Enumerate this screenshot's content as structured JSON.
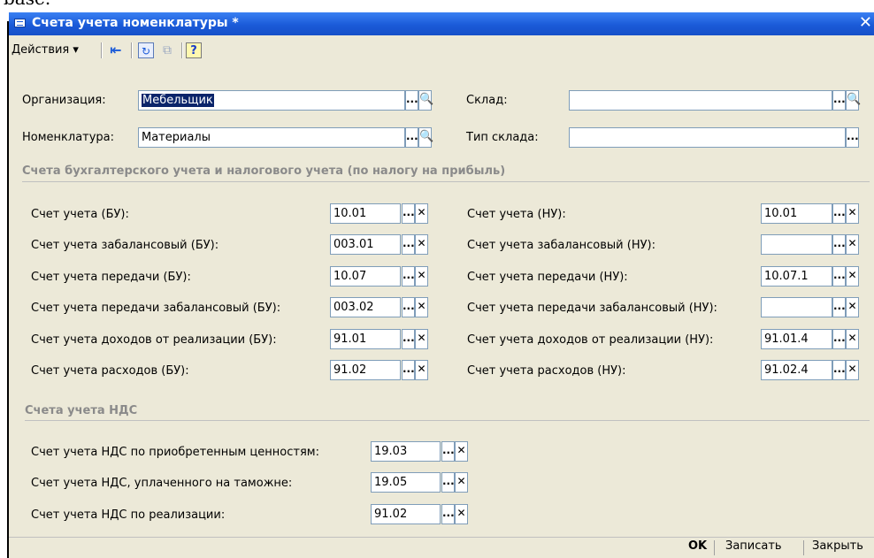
{
  "background": {
    "text": "base."
  },
  "window": {
    "title": "Счета учета номенклатуры *",
    "close_label": "✕"
  },
  "toolbar": {
    "actions_label": "Действия ▾",
    "icons": [
      "back-arrow-icon",
      "refresh-icon",
      "copy-icon",
      "help-icon"
    ],
    "help_glyph": "?"
  },
  "header_fields": {
    "organization": {
      "label": "Организация:",
      "value": "Мебельщик"
    },
    "nomenclature": {
      "label": "Номенклатура:",
      "value": "Материалы"
    },
    "warehouse": {
      "label": "Склад:",
      "value": ""
    },
    "warehouse_type": {
      "label": "Тип склада:",
      "value": ""
    }
  },
  "section_bu": {
    "title": "Счета бухгалтерского учета и налогового учета (по налогу на прибыль)",
    "left": [
      {
        "label": "Счет учета (БУ):",
        "value": "10.01"
      },
      {
        "label": "Счет учета забалансовый (БУ):",
        "value": "003.01"
      },
      {
        "label": "Счет учета передачи (БУ):",
        "value": "10.07"
      },
      {
        "label": "Счет учета передачи забалансовый (БУ):",
        "value": "003.02"
      },
      {
        "label": "Счет учета доходов от реализации (БУ):",
        "value": "91.01"
      },
      {
        "label": "Счет учета расходов (БУ):",
        "value": "91.02"
      }
    ],
    "right": [
      {
        "label": "Счет учета (НУ):",
        "value": "10.01"
      },
      {
        "label": "Счет учета забалансовый (НУ):",
        "value": ""
      },
      {
        "label": "Счет учета передачи (НУ):",
        "value": "10.07.1"
      },
      {
        "label": "Счет учета передачи забалансовый (НУ):",
        "value": ""
      },
      {
        "label": "Счет учета доходов от реализации (НУ):",
        "value": "91.01.4"
      },
      {
        "label": "Счет учета расходов (НУ):",
        "value": "91.02.4"
      }
    ]
  },
  "section_vat": {
    "title": "Счета учета НДС",
    "rows": [
      {
        "label": "Счет учета НДС по приобретенным ценностям:",
        "value": "19.03"
      },
      {
        "label": "Счет учета НДС, уплаченного на таможне:",
        "value": "19.05"
      },
      {
        "label": "Счет учета НДС по реализации:",
        "value": "91.02"
      }
    ]
  },
  "field_buttons": {
    "select": "...",
    "clear": "✕",
    "search": "🔍"
  },
  "footer": {
    "ok": "OK",
    "save": "Записать",
    "close": "Закрыть"
  },
  "colors": {
    "titlebar": "#1a5ad8",
    "window_bg": "#ece9d8",
    "selection": "#0a246a",
    "section_title": "#8a8a8a"
  }
}
